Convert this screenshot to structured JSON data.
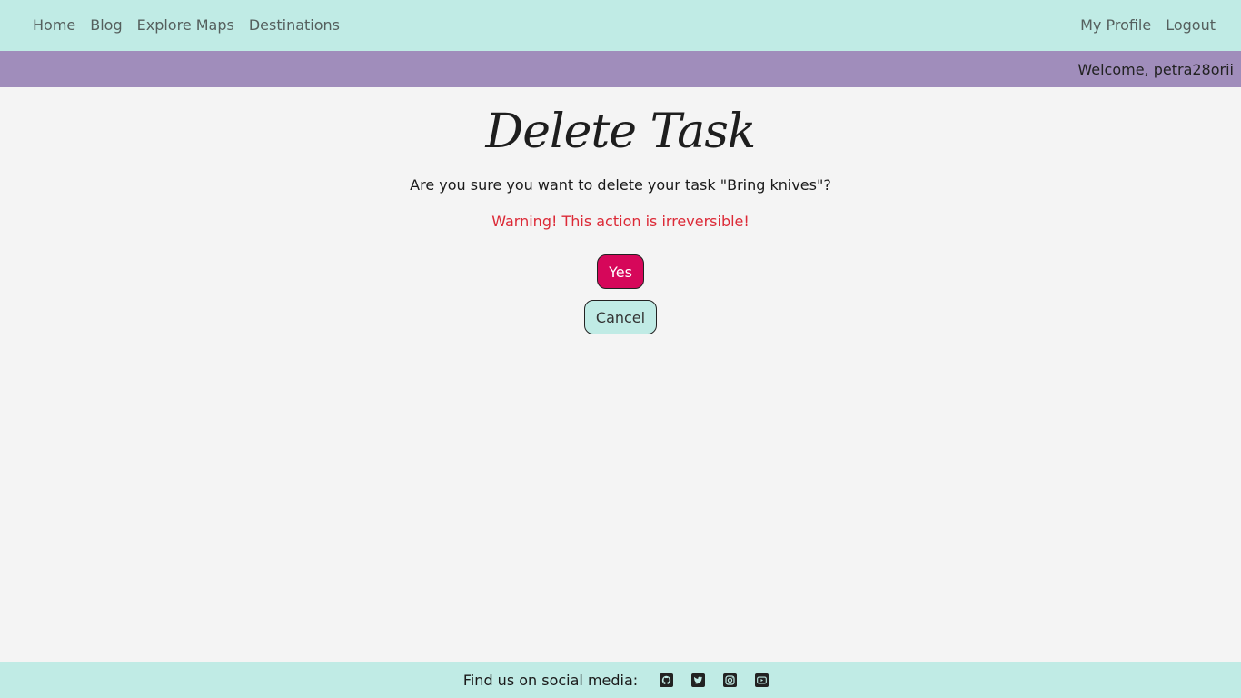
{
  "nav": {
    "left": [
      {
        "label": "Home"
      },
      {
        "label": "Blog"
      },
      {
        "label": "Explore Maps"
      },
      {
        "label": "Destinations"
      }
    ],
    "right": [
      {
        "label": "My Profile"
      },
      {
        "label": "Logout"
      }
    ]
  },
  "welcome": {
    "text": "Welcome, petra28orii"
  },
  "main": {
    "title": "Delete Task",
    "question": "Are you sure you want to delete your task \"Bring knives\"?",
    "warning": "Warning! This action is irreversible!",
    "yes_label": "Yes",
    "cancel_label": "Cancel"
  },
  "footer": {
    "text": "Find us on social media:",
    "icons": [
      "github-icon",
      "twitter-icon",
      "instagram-icon",
      "youtube-icon"
    ]
  },
  "colors": {
    "nav_bg": "#c0ebe5",
    "welcome_bg": "#a08dbb",
    "yes_button": "#d6075a",
    "warning_text": "#dc2a37"
  }
}
